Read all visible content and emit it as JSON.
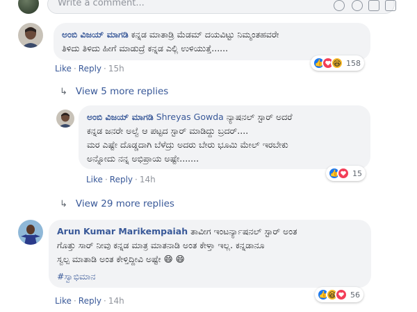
{
  "composer": {
    "placeholder": "Write a comment..."
  },
  "comments": [
    {
      "author": "ಅಂಬಿ ವಿಜಯ್ ಮಾಗಡಿ",
      "line1": "ಕನ್ನಡ ಮಾತಾಡ್ರಿ ಮೆಡಮ್ ದಯವಿಟ್ಟು ನಿಮ್ಮಂತಹವರೇ",
      "line2": "ತಿಳಿದು ತಿಳಿದು ಹೀಗೆ ಮಾಡುದ್ರೆ ಕನ್ನಡ ಎಲ್ಲಿ ಉಳಿಯುತ್ತೆ......",
      "like": "Like",
      "reply": "Reply",
      "time": "15h",
      "reaction_count": "158"
    },
    {
      "author": "ಅಂಬಿ ವಿಜಯ್ ಮಾಗಡಿ",
      "mention": "Shreyas Gowda",
      "line1_rest": "ನ್ಯಾಷನಲ್ ಸ್ಟಾರ್ ಅದರೆ",
      "line2": "ಕನ್ನಡ ಜನರೇ ಅಲ್ವೆ ಆ ಪಟ್ಟದ ಸ್ಟಾರ್ ಮಾಡಿದ್ದು ಬ್ರದರ್....",
      "line3": "ಮರ ಎಷ್ಟೇ ದೊಡ್ಡದಾಗಿ ಬೆಳೆದ್ರು ಅದರು ಬೇರು ಭೂಮಿ ಮೇಲ್ ಇರಬೇಕು",
      "line4": "ಅನ್ನೋದು ನನ್ನ ಅಭಿಪ್ರಾಯ ಅಷ್ಟೇ.......",
      "like": "Like",
      "reply": "Reply",
      "time": "14h",
      "reaction_count": "15"
    },
    {
      "author": "Arun Kumar Marikempaiah",
      "line1_rest": "ತಾವೀಗ ಇಂಟರ್ನ್ಯಾಷನಲ್ ಸ್ಟಾರ್ ಅಂತ",
      "line2": "ಗೊತ್ತು ಸಾರ್ ನೀವು ಕನ್ನಡ ಮಾತ್ರ ಮಾತನಾಡಿ ಅಂತ ಕೇಳ್ತಾ ಇಲ್ಲ. ಕನ್ನಡಾನೂ",
      "line3": "ಸ್ವಲ್ಪ ಮಾತಾಡಿ ಅಂತ ಕೇಳ್ತಿದ್ದೀವಿ ಅಷ್ಟೇ 😄 😄",
      "hashtag": "#ಸ್ವಾಭಿಮಾನ",
      "like": "Like",
      "reply": "Reply",
      "time": "14h",
      "reaction_count": "56"
    }
  ],
  "view_more_1": "View 5 more replies",
  "view_more_2": "View 29 more replies",
  "icons": {
    "like": "👍",
    "haha": "😆",
    "love": "❤",
    "reply_arrow": "↳"
  },
  "colors": {
    "link": "#385898",
    "bubble": "#f2f3f5",
    "like_blue": "#1877f2",
    "love_red": "#f33e58",
    "haha_yellow": "#f7b928"
  }
}
